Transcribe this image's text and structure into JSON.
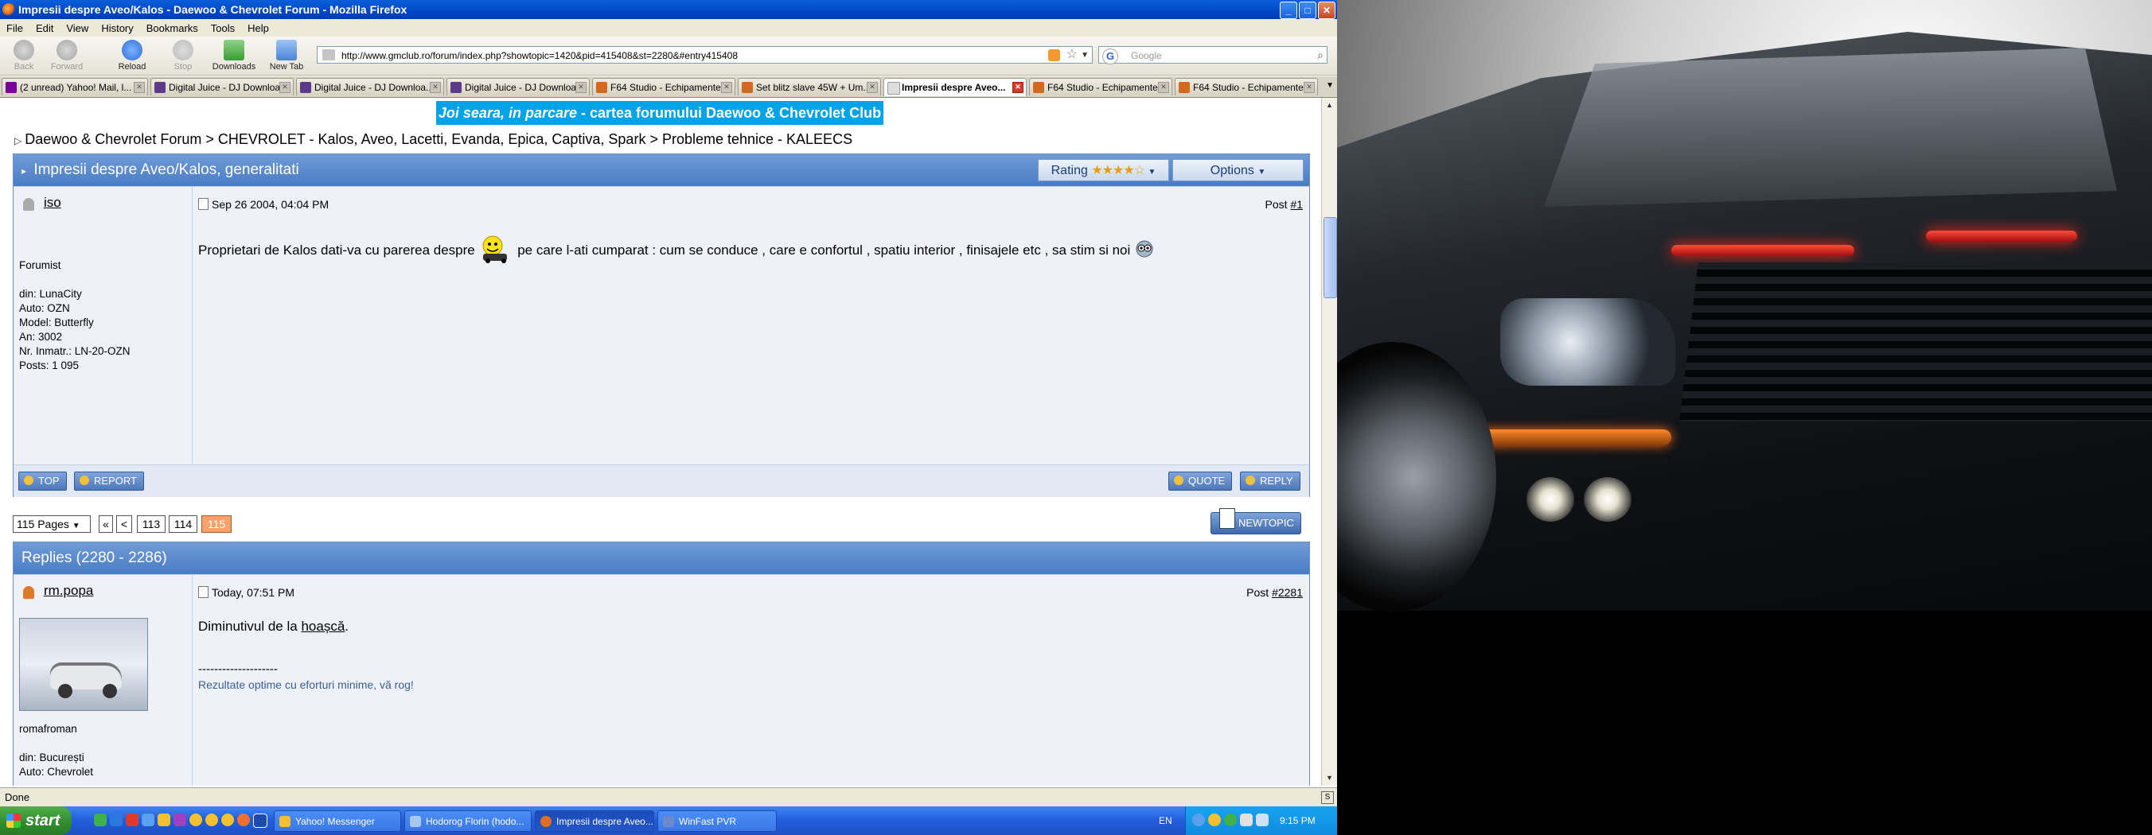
{
  "window": {
    "title": "Impresii despre Aveo/Kalos - Daewoo & Chevrolet Forum - Mozilla Firefox"
  },
  "menu": [
    "File",
    "Edit",
    "View",
    "History",
    "Bookmarks",
    "Tools",
    "Help"
  ],
  "nav": {
    "back": "Back",
    "forward": "Forward",
    "reload": "Reload",
    "stop": "Stop",
    "downloads": "Downloads",
    "new_tab": "New Tab",
    "url": "http://www.gmclub.ro/forum/index.php?showtopic=1420&pid=415408&st=2280&#entry415408",
    "search_placeholder": "Google"
  },
  "tabs": [
    {
      "label": "(2 unread) Yahoo! Mail, l...",
      "color": "#7b0099"
    },
    {
      "label": "Digital Juice - DJ Downloa...",
      "color": "#5b3a8a"
    },
    {
      "label": "Digital Juice - DJ Downloa...",
      "color": "#5b3a8a"
    },
    {
      "label": "Digital Juice - DJ Downloa...",
      "color": "#5b3a8a"
    },
    {
      "label": "F64 Studio - Echipamente...",
      "color": "#d2691e"
    },
    {
      "label": "Set blitz slave 45W + Um...",
      "color": "#d2691e"
    },
    {
      "label": "Impresii despre Aveo...",
      "color": "#cccccc",
      "active": true
    },
    {
      "label": "F64 Studio - Echipamente...",
      "color": "#d2691e"
    },
    {
      "label": "F64 Studio - Echipamente...",
      "color": "#d2691e"
    }
  ],
  "page": {
    "promo_italic": "Joi seara, in parcare",
    "promo_rest": " - cartea forumului Daewoo & Chevrolet Club",
    "breadcrumb": "Daewoo & Chevrolet Forum > CHEVROLET - Kalos, Aveo, Lacetti, Evanda, Epica, Captiva, Spark > Probleme tehnice - KALEECS",
    "topic_title": "Impresii despre Aveo/Kalos, generalitati",
    "rating_label": "Rating",
    "options_label": "Options",
    "first_post": {
      "username": "iso",
      "date": "Sep 26 2004, 04:04 PM",
      "post_label": "Post ",
      "post_num": "#1",
      "user_info": "Forumist\n\ndin: LunaCity\nAuto: OZN\nModel: Butterfly\nAn: 3002\nNr. Inmatr.: LN-20-OZN\nPosts: 1 095",
      "body_part1": "Proprietari de Kalos dati-va cu parerea despre",
      "body_part2": "pe care l-ati cumparat : cum se conduce , care e confortul , spatiu interior , finisajele etc , sa stim si noi"
    },
    "buttons": {
      "top": "TOP",
      "report": "REPORT",
      "quote": "QUOTE",
      "reply": "REPLY"
    },
    "pages_label": "115 Pages",
    "pagination": [
      "«",
      "<",
      "113",
      "114",
      "115"
    ],
    "new_topic": "NEWTOPIC",
    "replies_header": "Replies (2280 - 2286)",
    "reply_post": {
      "username": "rm.popa",
      "date": "Today, 07:51 PM",
      "post_label": "Post ",
      "post_num": "#2281",
      "body_prefix": "Diminutivul de la ",
      "body_link": "hoașcă",
      "body_suffix": ".",
      "sig_line": "--------------------",
      "sig_text": "Rezultate optime cu eforturi minime, vă rog!",
      "user_info": "romafroman\n\ndin: București\nAuto: Chevrolet"
    }
  },
  "status": "Done",
  "taskbar": {
    "start": "start",
    "tasks": [
      "Yahoo! Messenger",
      "Hodorog Florin (hodo...",
      "Impresii despre Aveo...",
      "WinFast PVR"
    ],
    "lang": "EN",
    "time": "9:15 PM"
  }
}
